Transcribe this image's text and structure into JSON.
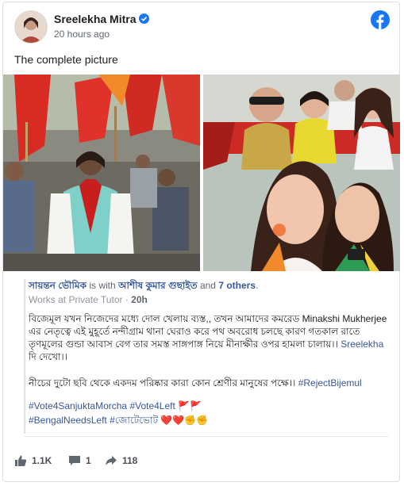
{
  "post": {
    "author": "Sreelekha Mitra",
    "time": "20 hours ago",
    "text": "The complete picture"
  },
  "shared": {
    "author": "সায়ন্তন ভৌমিক",
    "with_text": " is with ",
    "tagged": "আশীষ কুমার গুছাইত",
    "and_text": " and ",
    "others": "7 others",
    "period": ".",
    "job": "Works at Private Tutor",
    "sep": " · ",
    "age": "20h",
    "para1": "বিজেমূল যখন নিজেদের মধ্যে দোল খেলায় ব্যস্ত,, তখন আমাদের কমরেড Minakshi Mukherjee এর নেতৃত্বে এই মুহূর্তে নন্দীগ্রাম থানা ঘেরাও করে পথ অবরোধ চলছে কারণ গতকাল রাতে তৃণমূলের গুন্ডা আবাস বেগ তার সমস্ত সাঙ্গপাঙ্গ নিয়ে মীনাক্ষীর ওপর হামলা চালায়।। ",
    "para1_link": "Sreelekha",
    "para1_end": " দি দেখো।।",
    "para2": "নীচের দুটো ছবি থেকে একদম পরিষ্কার কারা কোন শ্রেণীর মানুষের পক্ষে।। ",
    "para2_tag": "#RejectBijemul",
    "tags_line1_a": "#Vote4SanjuktaMorcha",
    "tags_line1_b": "#Vote4Left",
    "tags_line1_emoji": "🚩🚩",
    "tags_line2_a": "#BengalNeedsLeft",
    "tags_line2_b": "#জোটেভোট",
    "tags_line2_emoji": "❤️❤️✊✊"
  },
  "actions": {
    "likes": "1.1K",
    "comments": "1",
    "shares": "118"
  },
  "colors": {
    "link": "#385898",
    "facebook_blue": "#1877f2",
    "flag_red": "#d32f2f"
  }
}
